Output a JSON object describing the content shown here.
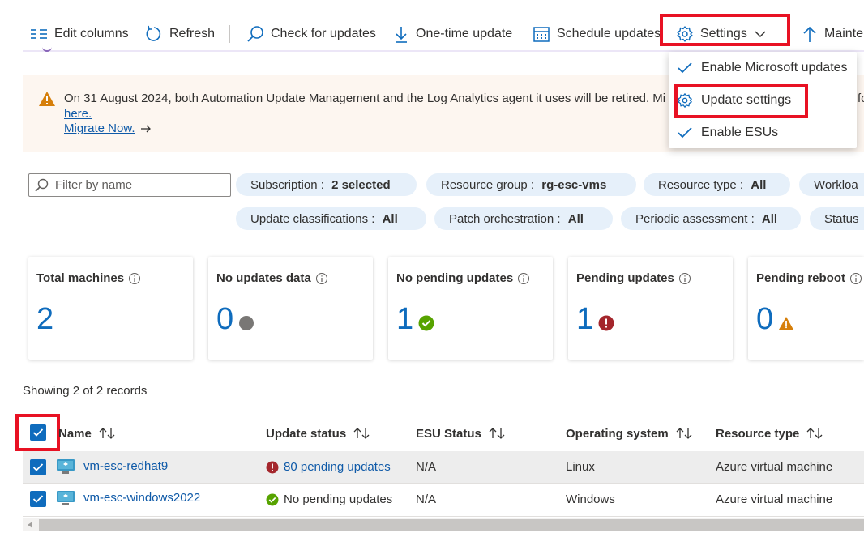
{
  "toolbar": {
    "edit_columns": "Edit columns",
    "refresh": "Refresh",
    "check_for_updates": "Check for updates",
    "one_time_update": "One-time update",
    "schedule_updates": "Schedule updates",
    "settings": "Settings",
    "maintenance": "Mainte"
  },
  "settings_menu": {
    "items": [
      {
        "label": "Enable Microsoft updates",
        "icon": "check-icon"
      },
      {
        "label": "Update settings",
        "icon": "gear-icon"
      },
      {
        "label": "Enable ESUs",
        "icon": "check-icon"
      }
    ]
  },
  "banner": {
    "text": "On 31 August 2024, both Automation Update Management and the Log Analytics agent it uses will be retired. Mi",
    "trailing": "fo",
    "here_link": "here.",
    "migrate_link": "Migrate Now.",
    "icon": "warning-icon"
  },
  "filters": {
    "search_placeholder": "Filter by name",
    "pills": [
      {
        "key": "Subscription",
        "value": "2 selected"
      },
      {
        "key": "Resource group",
        "value": "rg-esc-vms"
      },
      {
        "key": "Resource type",
        "value": "All"
      },
      {
        "key": "Workloa",
        "value": ""
      },
      {
        "key": "Update classifications",
        "value": "All"
      },
      {
        "key": "Patch orchestration",
        "value": "All"
      },
      {
        "key": "Periodic assessment",
        "value": "All"
      },
      {
        "key": "Status",
        "value": ""
      }
    ],
    "separator": " : "
  },
  "cards": [
    {
      "title": "Total machines",
      "value": "2",
      "status_icon": ""
    },
    {
      "title": "No updates data",
      "value": "0",
      "status_icon": "gray-dot-icon"
    },
    {
      "title": "No pending updates",
      "value": "1",
      "status_icon": "green-check-icon"
    },
    {
      "title": "Pending updates",
      "value": "1",
      "status_icon": "red-exclamation-icon"
    },
    {
      "title": "Pending reboot",
      "value": "0",
      "status_icon": "orange-warning-icon"
    }
  ],
  "table": {
    "showing": "Showing 2 of 2 records",
    "columns": [
      "Name",
      "Update status",
      "ESU Status",
      "Operating system",
      "Resource type"
    ],
    "rows": [
      {
        "name": "vm-esc-redhat9",
        "update_status": "80 pending updates",
        "status_kind": "error",
        "esu": "N/A",
        "os": "Linux",
        "resource_type": "Azure virtual machine",
        "selected": true
      },
      {
        "name": "vm-esc-windows2022",
        "update_status": "No pending updates",
        "status_kind": "ok",
        "esu": "N/A",
        "os": "Windows",
        "resource_type": "Azure virtual machine",
        "selected": true
      }
    ]
  },
  "colors": {
    "accent": "#0f6cbd",
    "highlight_box": "#e81123",
    "warning": "#d67f0b",
    "error": "#a4262c",
    "success": "#107c10"
  }
}
